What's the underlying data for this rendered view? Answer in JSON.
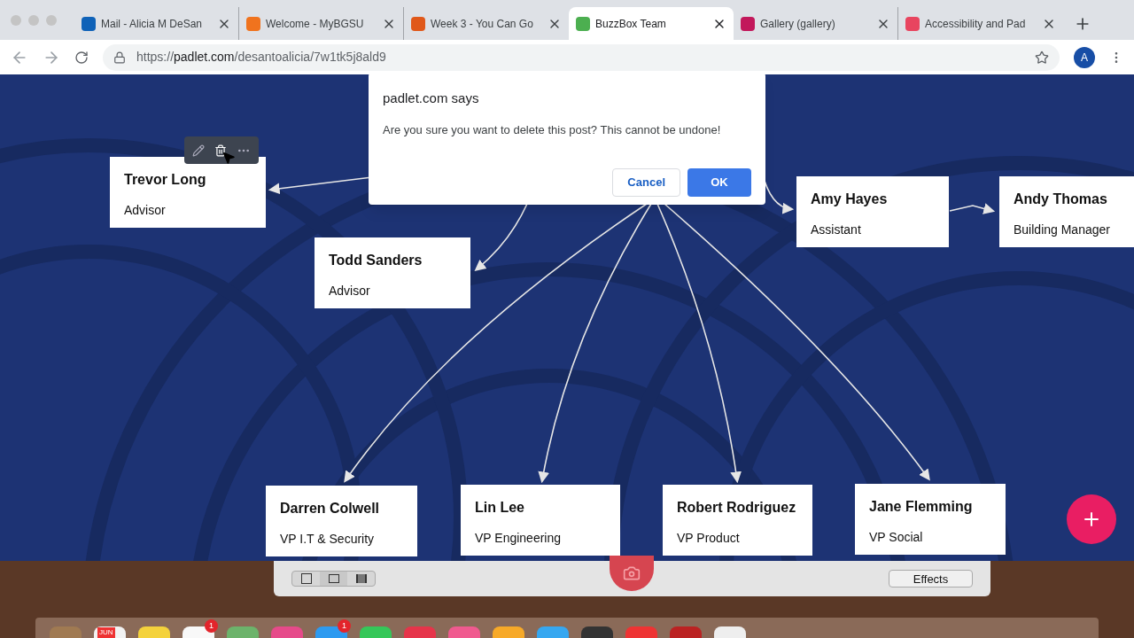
{
  "tabs": [
    {
      "title": "Mail - Alicia M DeSan",
      "selected": false,
      "color": "#0f62b8"
    },
    {
      "title": "Welcome - MyBGSU",
      "selected": false,
      "color": "#f0731e"
    },
    {
      "title": "Week 3 - You Can Go",
      "selected": false,
      "color": "#e0581a"
    },
    {
      "title": "BuzzBox Team",
      "selected": true,
      "color": "#4caf50"
    },
    {
      "title": "Gallery (gallery)",
      "selected": false,
      "color": "#c2185b"
    },
    {
      "title": "Accessibility and Pad",
      "selected": false,
      "color": "#e8455f"
    }
  ],
  "address_bar": {
    "scheme": "https://",
    "host": "padlet.com",
    "path": "/desantoalicia/7w1tk5j8ald9"
  },
  "profile_initial": "A",
  "dialog": {
    "title": "padlet.com says",
    "message": "Are you sure you want to delete this post? This cannot be undone!",
    "buttons": [
      {
        "label": "Cancel",
        "kind": "secondary"
      },
      {
        "label": "OK",
        "kind": "primary"
      }
    ]
  },
  "posts": [
    {
      "name": "Trevor Long",
      "role": "Advisor"
    },
    {
      "name": "Todd Sanders",
      "role": "Advisor"
    },
    {
      "name": "Amy Hayes",
      "role": "Assistant"
    },
    {
      "name": "Andy Thomas",
      "role": "Building Manager"
    },
    {
      "name": "Darren Colwell",
      "role": "VP I.T & Security"
    },
    {
      "name": "Lin Lee",
      "role": "VP Engineering"
    },
    {
      "name": "Robert Rodriguez",
      "role": "VP Product"
    },
    {
      "name": "Jane Flemming",
      "role": "VP Social"
    }
  ],
  "photo_booth": {
    "effects_button": "Effects"
  },
  "dock": {
    "calendar_month": "JUN",
    "badges": [
      "1",
      "1"
    ]
  }
}
